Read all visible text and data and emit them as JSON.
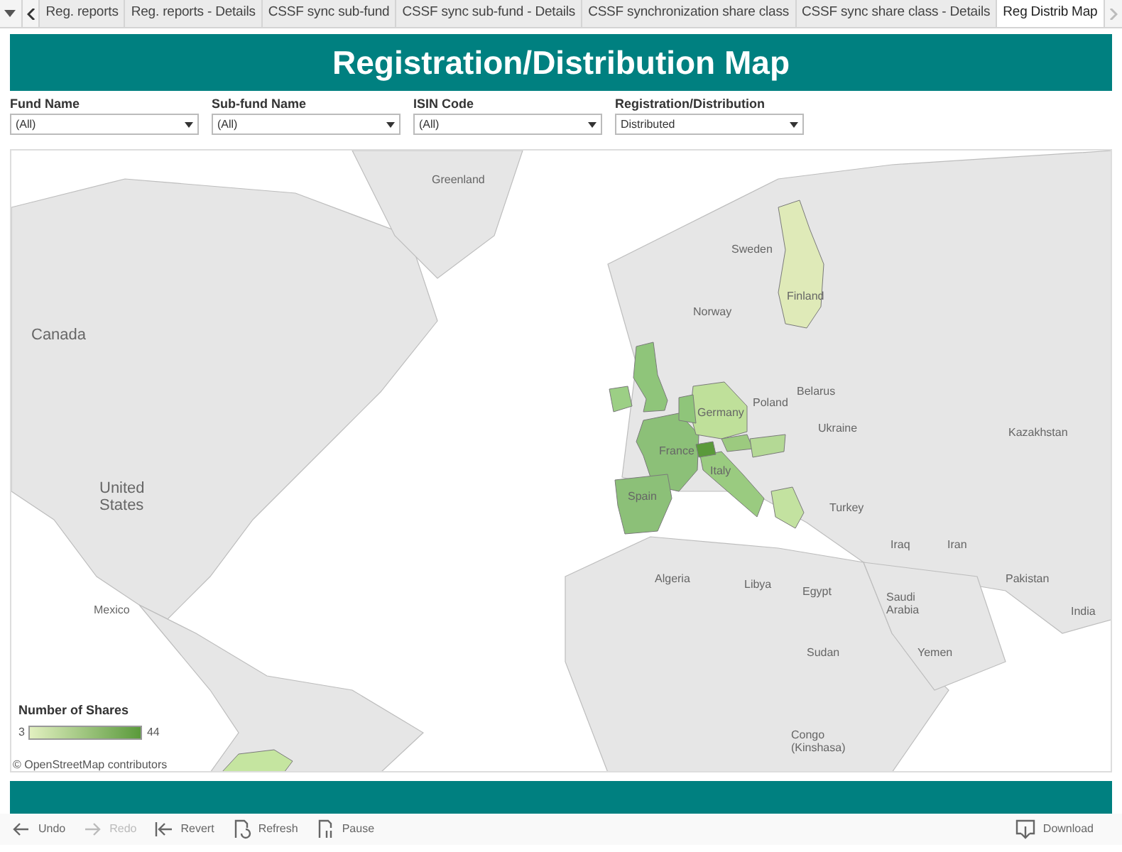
{
  "tabs": [
    {
      "label": "Reg. reports",
      "selected": false
    },
    {
      "label": "Reg. reports - Details",
      "selected": false
    },
    {
      "label": "CSSF sync sub-fund",
      "selected": false
    },
    {
      "label": "CSSF sync sub-fund - Details",
      "selected": false
    },
    {
      "label": "CSSF synchronization share class",
      "selected": false
    },
    {
      "label": "CSSF sync share class - Details",
      "selected": false
    },
    {
      "label": "Reg Distrib Map",
      "selected": true
    }
  ],
  "title": "Registration/Distribution Map",
  "filters": [
    {
      "label": "Fund Name",
      "value": "(All)"
    },
    {
      "label": "Sub-fund Name",
      "value": "(All)"
    },
    {
      "label": "ISIN Code",
      "value": "(All)"
    },
    {
      "label": "Registration/Distribution",
      "value": "Distributed"
    }
  ],
  "map": {
    "places": [
      "Greenland",
      "Canada",
      "United States",
      "Mexico",
      "Sweden",
      "Norway",
      "Finland",
      "Belarus",
      "Poland",
      "Ukraine",
      "Kazakhstan",
      "Germany",
      "France",
      "Italy",
      "Spain",
      "Turkey",
      "Iraq",
      "Iran",
      "Algeria",
      "Libya",
      "Egypt",
      "Saudi Arabia",
      "Pakistan",
      "India",
      "Yemen",
      "Sudan",
      "Congo (Kinshasa)"
    ],
    "regions": [
      {
        "color": "#dfeab8"
      },
      {
        "color": "#8fc57a"
      },
      {
        "color": "#9ccf85"
      },
      {
        "color": "#8cc078"
      },
      {
        "color": "#8cc078"
      },
      {
        "color": "#bfe09a"
      },
      {
        "color": "#8fc57a"
      },
      {
        "color": "#9acb80"
      },
      {
        "color": "#9cca7f"
      },
      {
        "color": "#b4d995"
      },
      {
        "color": "#c3e2a0"
      },
      {
        "color": "#5a9a3a"
      },
      {
        "color": "#c5e5a0"
      }
    ],
    "legend": {
      "title": "Number of Shares",
      "min": "3",
      "max": "44"
    },
    "attribution": "© OpenStreetMap contributors"
  },
  "toolbar": [
    {
      "label": "Undo",
      "kind": "undo",
      "disabled": false
    },
    {
      "label": "Redo",
      "kind": "redo",
      "disabled": true
    },
    {
      "label": "Revert",
      "kind": "revert",
      "disabled": false
    },
    {
      "label": "Refresh",
      "kind": "refresh",
      "disabled": false
    },
    {
      "label": "Pause",
      "kind": "pause",
      "disabled": false
    },
    {
      "label": "Download",
      "kind": "download",
      "disabled": false
    }
  ]
}
